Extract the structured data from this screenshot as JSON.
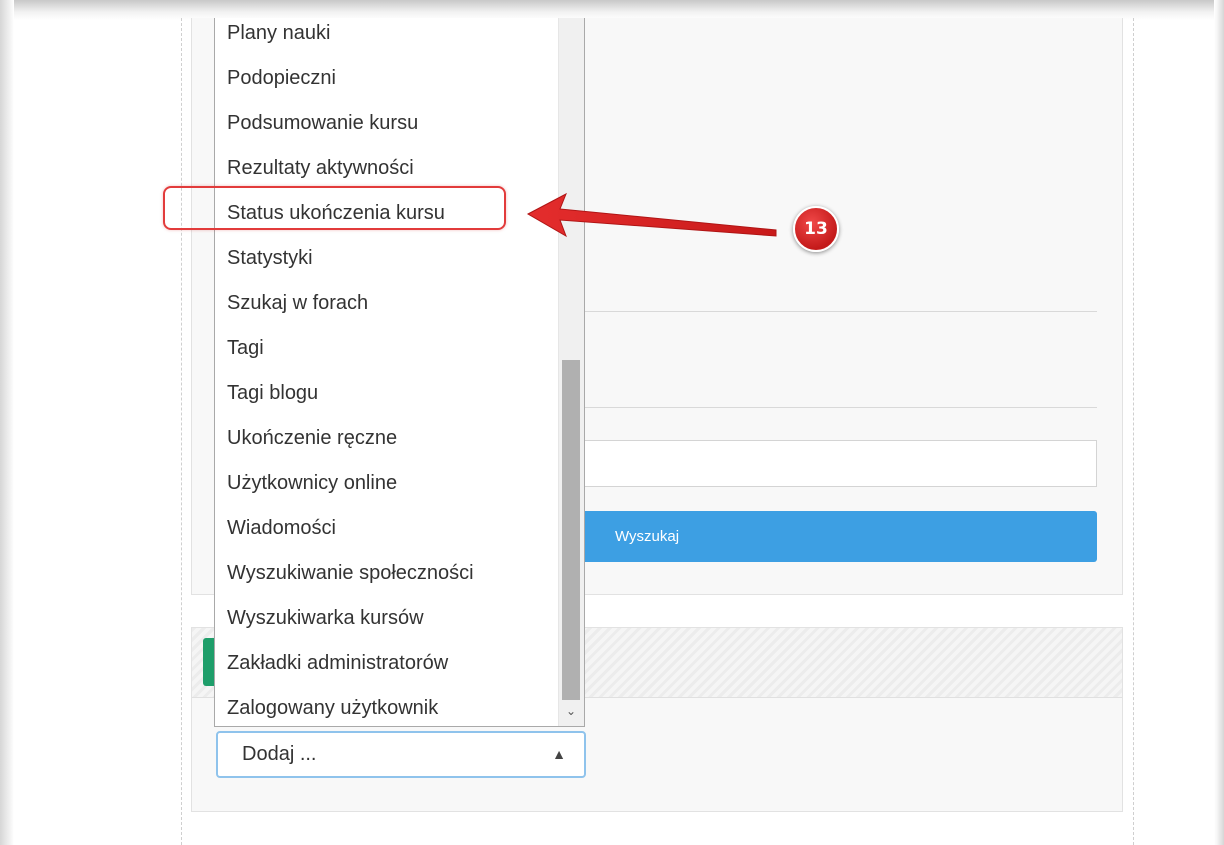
{
  "dropdown": {
    "items": [
      "Plany nauki",
      "Podopieczni",
      "Podsumowanie kursu",
      "Rezultaty aktywności",
      "Status ukończenia kursu",
      "Statystyki",
      "Szukaj w forach",
      "Tagi",
      "Tagi blogu",
      "Ukończenie ręczne",
      "Użytkownicy online",
      "Wiadomości",
      "Wyszukiwanie społeczności",
      "Wyszukiwarka kursów",
      "Zakładki administratorów",
      "Zalogowany użytkownik"
    ],
    "highlighted": "Status ukończenia kursu"
  },
  "search": {
    "button_label": "Wyszukaj",
    "input_value": ""
  },
  "add_block": {
    "selected": "Dodaj ..."
  },
  "annotation": {
    "step_number": "13",
    "color": "#e23b3b"
  },
  "colors": {
    "search_button": "#3d9fe3",
    "tab_accent": "#1e9e6a"
  }
}
